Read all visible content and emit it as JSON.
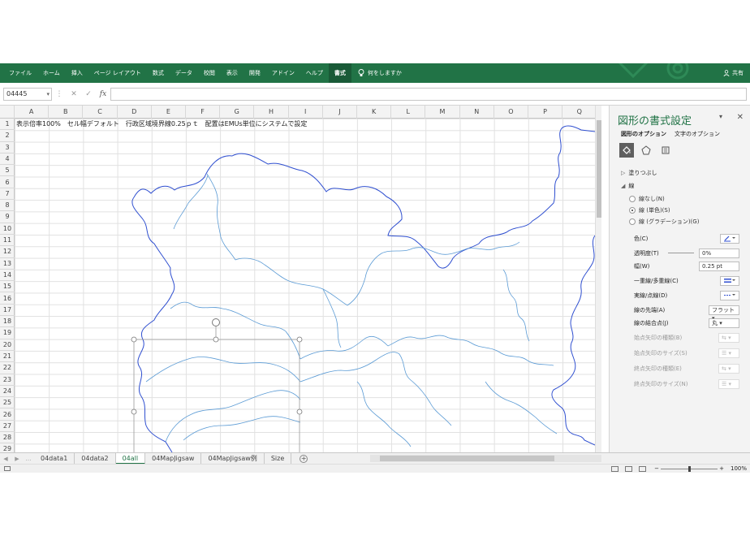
{
  "ribbon": {
    "tabs": [
      "ファイル",
      "ホーム",
      "挿入",
      "ページ レイアウト",
      "数式",
      "データ",
      "校閲",
      "表示",
      "開発",
      "アドイン",
      "ヘルプ",
      "書式"
    ],
    "active_tab": "書式",
    "tell_me": "何をしますか",
    "share": "共有"
  },
  "formula_bar": {
    "name_box": "04445",
    "fx": "fx",
    "value": ""
  },
  "grid": {
    "columns": [
      "A",
      "B",
      "C",
      "D",
      "E",
      "F",
      "G",
      "H",
      "I",
      "J",
      "K",
      "L",
      "M",
      "N",
      "O",
      "P",
      "Q"
    ],
    "rows": [
      "1",
      "2",
      "3",
      "4",
      "5",
      "6",
      "7",
      "8",
      "9",
      "10",
      "11",
      "12",
      "13",
      "14",
      "15",
      "16",
      "17",
      "18",
      "19",
      "20",
      "21",
      "22",
      "23",
      "24",
      "25",
      "26",
      "27",
      "28",
      "29"
    ],
    "a1_text": "表示倍率100%　セル幅デフォルト　行政区域境界線0.25ｐｔ　配置はEMUs単位にシステムで設定"
  },
  "panel": {
    "title": "図形の書式設定",
    "tab_shape": "図形のオプション",
    "tab_text": "文字のオプション",
    "section_fill": "塗りつぶし",
    "section_line": "線",
    "radio_none": "線なし(N)",
    "radio_solid": "線 (単色)(S)",
    "radio_gradient": "線 (グラデーション)(G)",
    "color_label": "色(C)",
    "transparency_label": "透明度(T)",
    "transparency_value": "0%",
    "width_label": "幅(W)",
    "width_value": "0.25 pt",
    "compound_label": "一重線/多重線(C)",
    "dash_label": "実線/点線(D)",
    "cap_label": "線の先端(A)",
    "cap_value": "フラット",
    "join_label": "線の結合点(J)",
    "join_value": "丸",
    "begin_arrow_type": "始点矢印の種類(B)",
    "begin_arrow_size": "始点矢印のサイズ(S)",
    "end_arrow_type": "終点矢印の種類(E)",
    "end_arrow_size": "終点矢印のサイズ(N)"
  },
  "sheets": [
    "04data1",
    "04data2",
    "04all",
    "04MapJigsaw",
    "04MapJigsaw例",
    "Size"
  ],
  "active_sheet": "04all",
  "status": {
    "zoom": "100%"
  },
  "colors": {
    "excel_green": "#217346",
    "border_blue": "#2f4fd0",
    "inner_blue": "#5b9bd5"
  }
}
